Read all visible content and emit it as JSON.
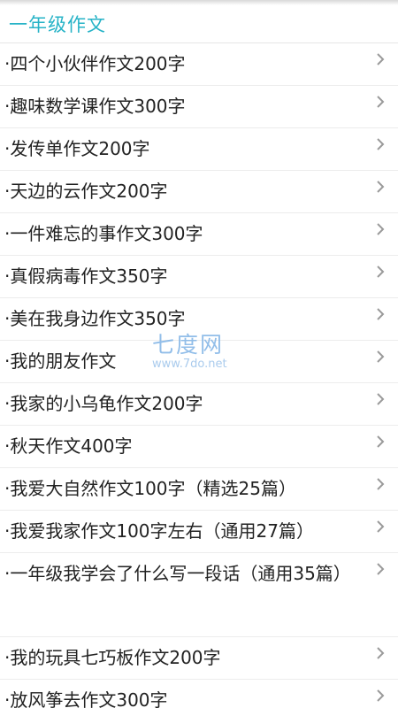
{
  "header": {
    "title": "一年级作文"
  },
  "items": [
    {
      "label": "·四个小伙伴作文200字"
    },
    {
      "label": "·趣味数学课作文300字"
    },
    {
      "label": "·发传单作文200字"
    },
    {
      "label": "·天边的云作文200字"
    },
    {
      "label": "·一件难忘的事作文300字"
    },
    {
      "label": "·真假病毒作文350字"
    },
    {
      "label": "·美在我身边作文350字"
    },
    {
      "label": "·我的朋友作文"
    },
    {
      "label": "·我家的小乌龟作文200字"
    },
    {
      "label": "·秋天作文400字"
    },
    {
      "label": "·我爱大自然作文100字（精选25篇）"
    },
    {
      "label": "·我爱我家作文100字左右（通用27篇）"
    },
    {
      "label": "·一年级我学会了什么写一段话（通用35篇）"
    },
    {
      "label": "·我的玩具七巧板作文200字"
    },
    {
      "label": "·放风筝去作文300字"
    }
  ],
  "watermark": {
    "logo": "七度网",
    "url": "www.7do.net"
  },
  "icons": {
    "row_arrow": "chevron-right-icon"
  },
  "colors": {
    "accent": "#27b3c7",
    "text": "#222222",
    "chevron": "#9a9a9a",
    "watermark": "#7fb3e6"
  }
}
